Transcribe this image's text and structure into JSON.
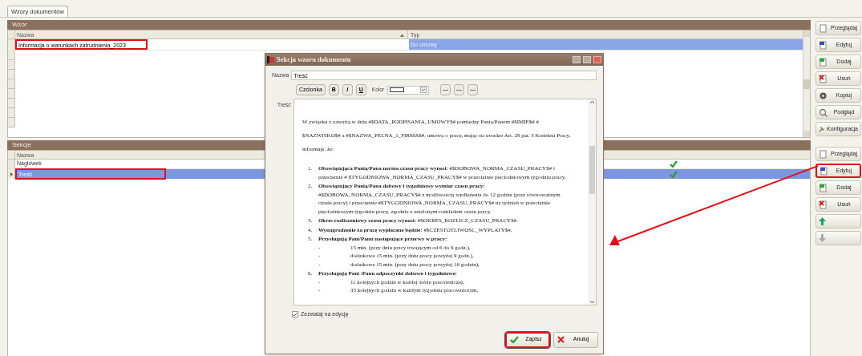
{
  "tab": {
    "label": "Wzory dokumentów",
    "selected": true
  },
  "template_panel": {
    "title": "Wzór",
    "columns": [
      "Nazwa",
      "Typ"
    ],
    "rows": [
      {
        "name": "Informacja o warunkach zatrudnienia_2023",
        "type": "Do umowy",
        "selected": true,
        "highlighted": true
      }
    ]
  },
  "template_buttons": [
    {
      "label": "Przeglądaj",
      "kind": "view",
      "disabled": false,
      "highlighted": false
    },
    {
      "label": "Edytuj",
      "kind": "edit",
      "disabled": false,
      "highlighted": false
    },
    {
      "label": "Dodaj",
      "kind": "add",
      "disabled": false,
      "highlighted": false
    },
    {
      "label": "Usuń",
      "kind": "delete",
      "disabled": false,
      "highlighted": false
    },
    {
      "label": "Kopiuj",
      "kind": "copy",
      "disabled": false,
      "highlighted": false
    },
    {
      "label": "Podgląd",
      "kind": "preview",
      "disabled": false,
      "highlighted": false
    },
    {
      "label": "Konfiguracja",
      "kind": "config",
      "disabled": false,
      "highlighted": false
    }
  ],
  "sections_panel": {
    "title": "Sekcje",
    "columns": [
      "Nazwa"
    ],
    "rows": [
      {
        "name": "Nagłówek",
        "checked": true,
        "selected": false,
        "highlighted": false
      },
      {
        "name": "Treść",
        "checked": true,
        "selected": true,
        "highlighted": true
      }
    ]
  },
  "section_buttons": [
    {
      "label": "Przeglądaj",
      "kind": "view",
      "disabled": false,
      "highlighted": false
    },
    {
      "label": "Edytuj",
      "kind": "edit",
      "disabled": false,
      "highlighted": true
    },
    {
      "label": "Dodaj",
      "kind": "add",
      "disabled": false,
      "highlighted": false
    },
    {
      "label": "Usuń",
      "kind": "delete",
      "disabled": false,
      "highlighted": false
    },
    {
      "kind": "up",
      "disabled": false,
      "highlighted": false
    },
    {
      "kind": "down",
      "disabled": true,
      "highlighted": false
    }
  ],
  "dialog": {
    "title": "Sekcja wzoru dokumentu",
    "name_label": "Nazwa",
    "name_value": "Treść",
    "toolbar": {
      "font_button": "Czcionka",
      "bold": "B",
      "italic": "I",
      "underline": "U",
      "color_label": "Kolor"
    },
    "content_label": "Treść",
    "intro": "W związku z zawartą w dniu #$DATA_PODPISANIA_UMOWY$# pomiędzy Panią/Panem #$IMIE$# # $NAZWISKO$# a #$NAZWA_PELNA_1_FIRMA$#, umową o pracę, mając na uwadze Art. 29 par. 3 Kodeksu Pracy, informuję, że:",
    "items": [
      {
        "number": "1.",
        "text": "**Obowiązująca Panią/Pana norma czasu pracy wynosi:** #$DOBOWA_NORMA_CZASU_PRACY$# i przeciętnie # $TYGODNIOWA_NORMA_CZASU_PRACY$# w przeciętnie pięciodniowym tygodniu pracy."
      },
      {
        "number": "2.",
        "text": "**Obowiązujący Panią/Pana dobowy i tygodniowy wymiar czasu pracy:** #$DOBOWA_NORMA_CZASU_PRACY$# z możliwością wydłużenia do 12 godzin (przy równoważnym czasie pracy) i przeciętnie #$TYGODNIOWA_NORMA_CZASU_PRACY$# na tydzień w przeciętnie pięciodniowym tygodniu pracy, zgodnie z ustalonym rozkładem czasu pracy."
      },
      {
        "number": "3.",
        "text": "**Okres rozliczeniowy czasu pracy wynosi:** #$OKRES_ROZLICZ_CZASU_PRACY$#."
      },
      {
        "number": "4.",
        "text": "**Wynagrodzenie za pracę wypłacane będzie:** #$CZESTOTLIWOSC_WYPLATY$#."
      },
      {
        "number": "5.",
        "text": "**Przysługują Pani/Panu następujące przerwy w pracy:**",
        "bullets": [
          {
            "marker": "-",
            "text": "15 min. (przy dniu pracy trwającym od 6 do 9 godz.),"
          },
          {
            "marker": "-",
            "text": "dodatkowe 15 min. (przy dniu pracy powyżej 9 godz.),"
          },
          {
            "marker": "-",
            "text": "dodatkowe 15 min. (przy dniu pracy powyżej 16 godzin),"
          }
        ]
      },
      {
        "number": "6.",
        "text": "**Przysługują Pani /Panu odpoczynki dobowe i tygodniowe:**",
        "bullets": [
          {
            "marker": "-",
            "text": "11 kolejnych godzin w każdej dobie pracowniczej,"
          },
          {
            "marker": "-",
            "text": "35 kolejnych godzin w każdym tygodniu pracowniczym,"
          }
        ]
      }
    ],
    "allow_edit": {
      "label": "Zezwalaj na edycję",
      "checked": true
    },
    "buttons": [
      {
        "label": "Zapisz",
        "kind": "save",
        "highlighted": true
      },
      {
        "label": "Anuluj",
        "kind": "cancel",
        "highlighted": false
      }
    ]
  }
}
